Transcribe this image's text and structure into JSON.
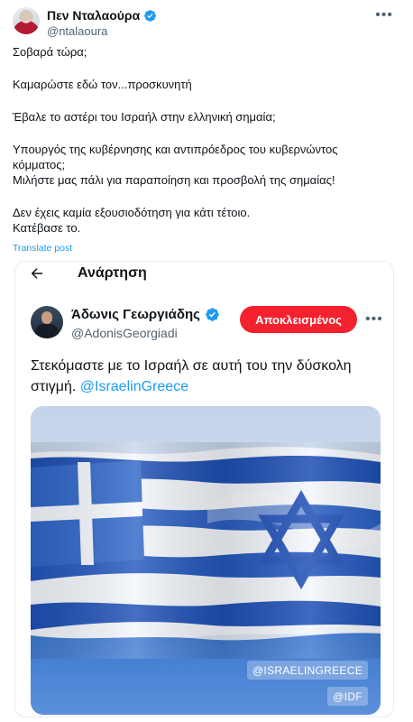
{
  "tweet": {
    "display_name": "Πεν Νταλαούρα",
    "handle": "@ntalaoura",
    "more_icon": "more-horizontal-icon",
    "verified_color": "#1d9bf0",
    "lines": [
      "Σοβαρά τώρα;",
      "Καμαρώστε εδώ τον...προσκυνητή",
      "Έβαλε το αστέρι του Ισραήλ στην ελληνική σημαία;",
      "Υπουργός της κυβέρνησης και αντιπρόεδρος του κυβερνώντος κόμματος;",
      "Μιλήστε μας πάλι για παραποίηση και προσβολή της σημαίας!",
      "Δεν έχεις καμία εξουσιοδότηση για κάτι τέτοιο.",
      "Κατέβασε το."
    ],
    "translate": "Translate post"
  },
  "embed": {
    "header_title": "Ανάρτηση",
    "back_icon": "arrow-left-icon",
    "author_name": "Άδωνις Γεωργιάδης",
    "author_handle": "@AdonisGeorgiadi",
    "block_label": "Αποκλεισμένος",
    "block_color": "#f4212e",
    "text": "Στεκόμαστε με το Ισραήλ σε αυτή του την δύσκολη στιγμή. ",
    "mention": "@IsraelinGreece",
    "media": {
      "watermark_1": "@ISRAELINGREECE",
      "watermark_2": "@IDF"
    }
  }
}
